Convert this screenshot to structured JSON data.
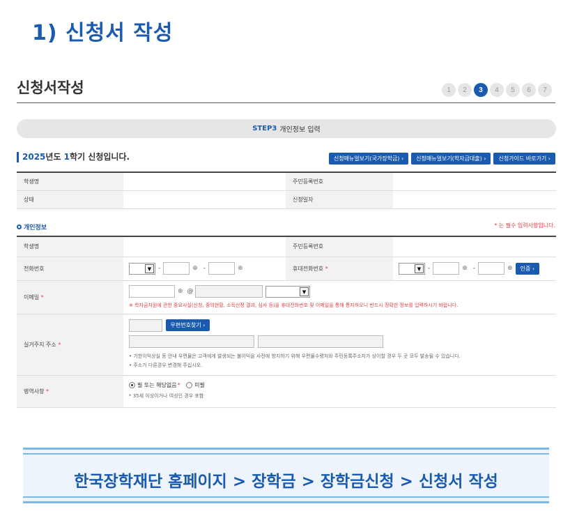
{
  "heading": "1) 신청서 작성",
  "page_title": "신청서작성",
  "steps": [
    "1",
    "2",
    "3",
    "4",
    "5",
    "6",
    "7"
  ],
  "active_step_index": 2,
  "step_bar": {
    "step": "STEP3",
    "text": "개인정보 입력"
  },
  "semester": {
    "year": "2025",
    "year_suffix": "년도 ",
    "term": "1",
    "term_suffix": "학기 신청입니다."
  },
  "guide_buttons": [
    "신청매뉴얼보기(국가장학금) ›",
    "신청매뉴얼보기(학자금대출) ›",
    "신청가이드 바로가기 ›"
  ],
  "summary": {
    "student_name_label": "학생명",
    "rrn_label": "주민등록번호",
    "status_label": "상태",
    "apply_date_label": "신청일자"
  },
  "personal": {
    "section_title": "개인정보",
    "required_note": "* 는 필수 입력사항입니다.",
    "student_name_label": "학생명",
    "rrn_label": "주민등록번호",
    "phone_label": "전화번호",
    "mobile_label": "휴대전화번호",
    "auth_button": "인증 ›",
    "email_label": "이메일",
    "email_at": "@",
    "email_note": "※ 학자금지원에 관한 중요사실(신청, 중의현황, 소득산정 결과, 심사 등)을 휴대전화번호 및 이메일을 통해 통지하오니 반드시 정확한 정보를 입력하시기 바랍니다.",
    "address_label": "실거주지 주소",
    "zip_button": "우편번호찾기 ›",
    "address_notes": [
      "• 기한이익상실 등 안내 우편물은 고객에게 발생되는 불이익을 사전에 방지하기 위해 우편물수령처와 주민등록주소지가 상이할 경우 두 곳 모두 발송될 수 있습니다.",
      "• 주소가 다른경우 변경해 주십시오."
    ],
    "military_label": "병역사항",
    "military_options": [
      "필 또는 해당없음",
      "미필"
    ],
    "military_selected": 0,
    "military_note": "* 35세 이상이거나 여성인 경우 포함",
    "required_mark": "*"
  },
  "footer": "한국장학재단 홈페이지 > 장학금 > 장학금신청 > 신청서 작성",
  "colors": {
    "brand": "#1a5bb0",
    "required": "#e04040"
  }
}
